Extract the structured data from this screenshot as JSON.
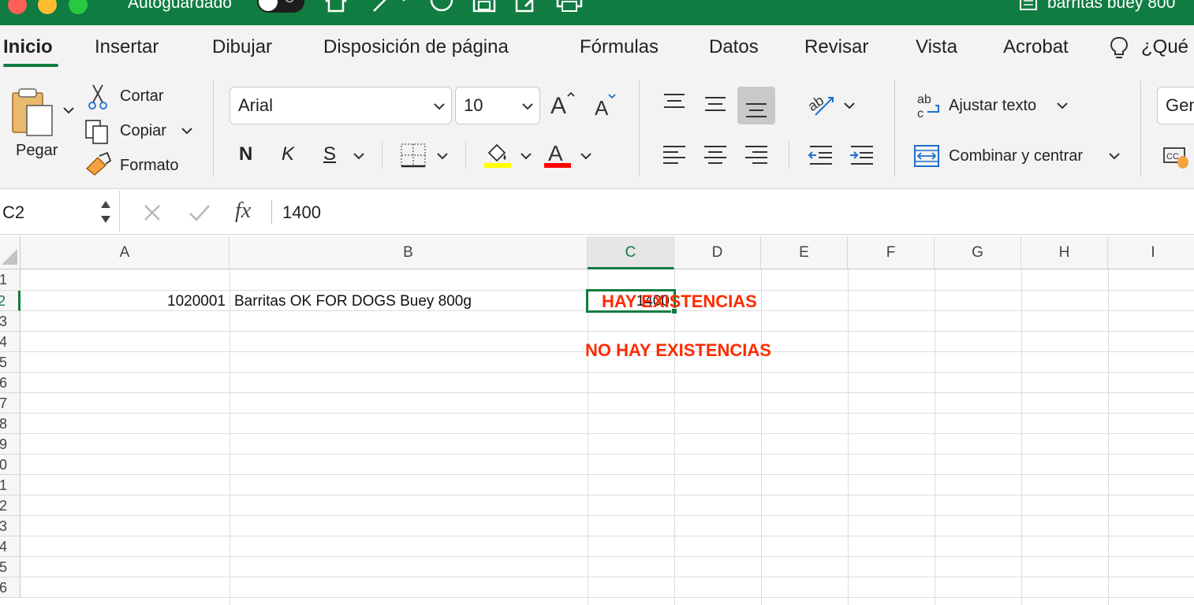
{
  "titlebar": {
    "autosave_label": "Autoguardado",
    "autosave_toggle": "O",
    "document_title": "barritas buey 800"
  },
  "tabs": [
    "Inicio",
    "Insertar",
    "Dibujar",
    "Disposición de página",
    "Fórmulas",
    "Datos",
    "Revisar",
    "Vista",
    "Acrobat",
    "¿Qué"
  ],
  "ribbon": {
    "paste_label": "Pegar",
    "cut_label": "Cortar",
    "copy_label": "Copiar",
    "format_label": "Formato",
    "font_name": "Arial",
    "font_size": "10",
    "bold": "N",
    "italic": "K",
    "underline": "S",
    "wrap_text": "Ajustar texto",
    "merge_center": "Combinar y centrar",
    "number_format": "Gen"
  },
  "formula_bar": {
    "cell_ref": "C2",
    "fx": "fx",
    "value": "1400"
  },
  "grid": {
    "columns": [
      "A",
      "B",
      "C",
      "D",
      "E",
      "F",
      "G",
      "H",
      "I"
    ],
    "selected_column": "C",
    "rows": [
      "1",
      "2",
      "3",
      "4",
      "5",
      "6",
      "7",
      "8",
      "9",
      "0",
      "1",
      "2",
      "3",
      "4",
      "5",
      "6"
    ],
    "selected_row": "2",
    "cells": {
      "A2": "1020001",
      "B2": "Barritas OK FOR DOGS Buey 800g",
      "C2": "1400"
    },
    "overlay_texts": {
      "hay": "HAY EXISTENCIAS",
      "no_hay": "NO HAY EXISTENCIAS"
    }
  },
  "colors": {
    "excel_green": "#107c41",
    "alert_red": "#ff2a00",
    "highlight_yellow": "#ffff00",
    "font_red": "#ff0000"
  }
}
